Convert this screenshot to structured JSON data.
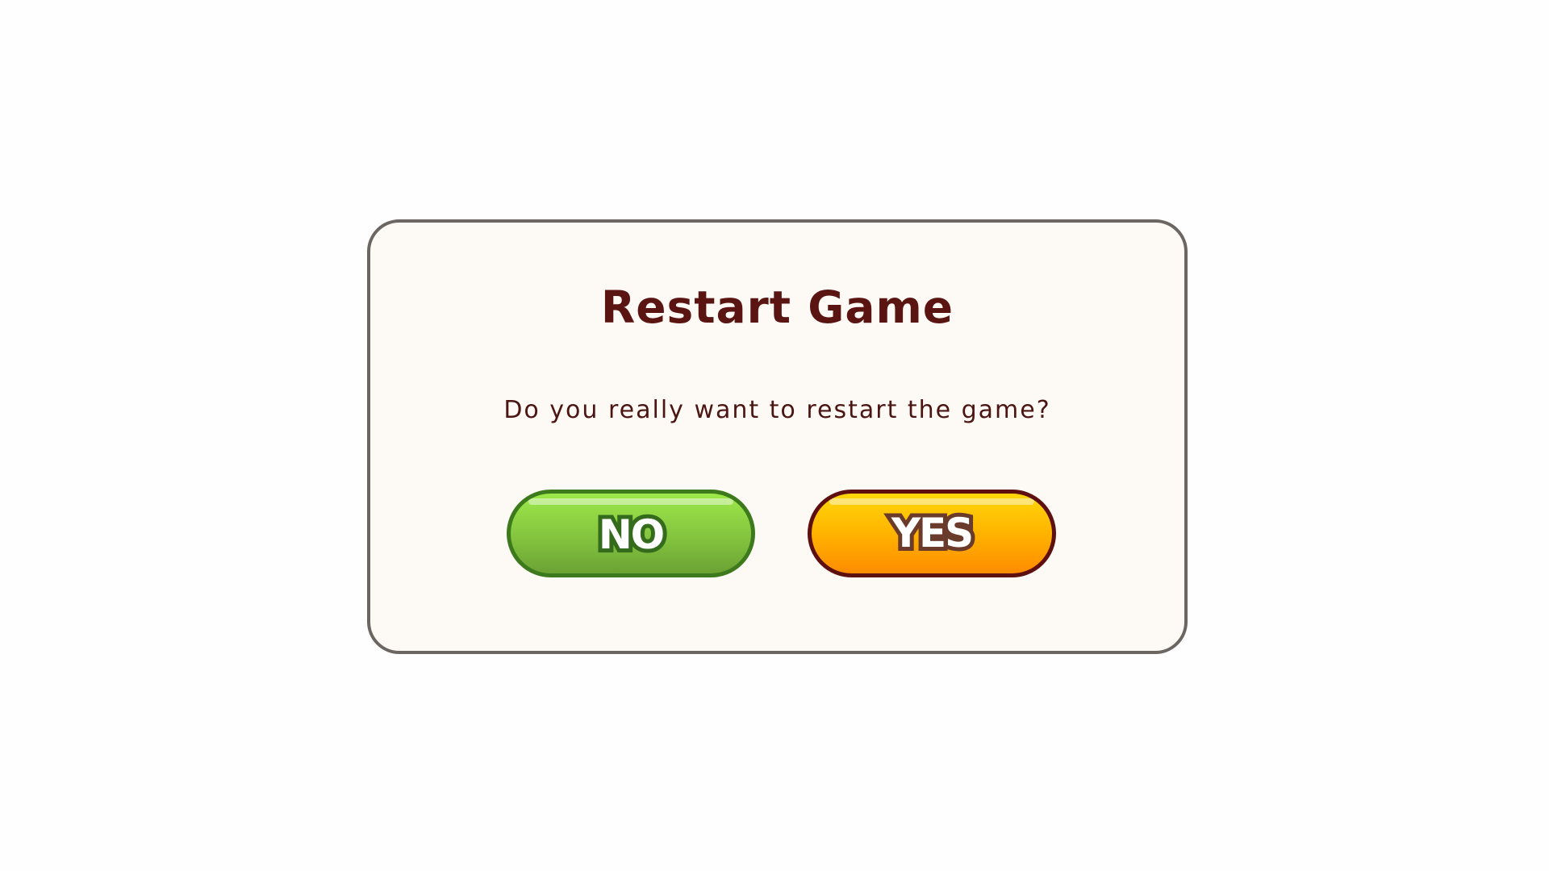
{
  "dialog": {
    "title": "Restart Game",
    "message": "Do you really want to restart the game?",
    "buttons": {
      "no_label": "NO",
      "yes_label": "YES"
    }
  },
  "colors": {
    "title_text": "#5a1512",
    "dialog_background": "#fdf9f4",
    "dialog_border": "#6b6661",
    "no_button": "#84c43f",
    "yes_button": "#ffb300"
  }
}
